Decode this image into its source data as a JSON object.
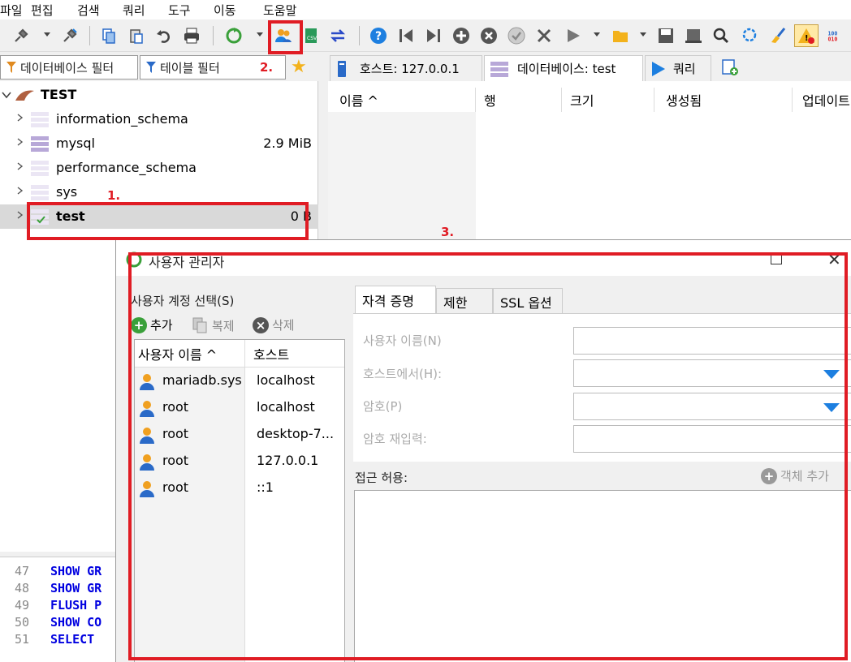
{
  "menu": [
    "파일",
    "편집",
    "검색",
    "쿼리",
    "도구",
    "이동",
    "도움말"
  ],
  "filters": {
    "db": "데이터베이스 필터",
    "table": "테이블 필터"
  },
  "tabs": [
    {
      "label": "호스트: 127.0.0.1"
    },
    {
      "label": "데이터베이스: test"
    },
    {
      "label": "쿼리"
    }
  ],
  "tree": {
    "root": "TEST",
    "items": [
      {
        "name": "information_schema",
        "size": ""
      },
      {
        "name": "mysql",
        "size": "2.9 MiB"
      },
      {
        "name": "performance_schema",
        "size": ""
      },
      {
        "name": "sys",
        "size": ""
      },
      {
        "name": "test",
        "size": "0 B"
      }
    ]
  },
  "list_headers": [
    "이름 ^",
    "행",
    "크기",
    "생성됨",
    "업데이트"
  ],
  "editor": [
    {
      "num": "47",
      "code": "SHOW GR"
    },
    {
      "num": "48",
      "code": "SHOW GR"
    },
    {
      "num": "49",
      "code": "FLUSH P"
    },
    {
      "num": "50",
      "code": "SHOW CO"
    },
    {
      "num": "51",
      "code": "SELECT"
    }
  ],
  "annotations": {
    "a1": "1.",
    "a2": "2.",
    "a3": "3."
  },
  "dialog": {
    "title": "사용자 관리자",
    "select_label": "사용자 계정 선택(S)",
    "add": "추가",
    "copy": "복제",
    "delete": "삭제",
    "col_user": "사용자 이름 ^",
    "col_host": "호스트",
    "users": [
      {
        "name": "mariadb.sys",
        "host": "localhost"
      },
      {
        "name": "root",
        "host": "localhost"
      },
      {
        "name": "root",
        "host": "desktop-7..."
      },
      {
        "name": "root",
        "host": "127.0.0.1"
      },
      {
        "name": "root",
        "host": "::1"
      }
    ],
    "tabs": [
      "자격 증명",
      "제한",
      "SSL 옵션"
    ],
    "fields": {
      "username": "사용자 이름(N)",
      "from_host": "호스트에서(H):",
      "password": "암호(P)",
      "repeat": "암호 재입력:"
    },
    "grant_label": "접근 허용:",
    "add_object": "객체 추가"
  },
  "colors": {
    "highlight": "#e01c24",
    "sql_keyword": "#0000e0",
    "dropdown_arrow": "#1d7fe0"
  }
}
